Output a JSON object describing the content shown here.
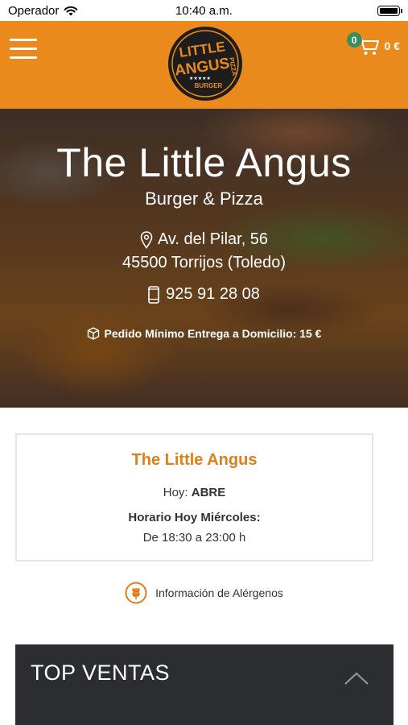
{
  "status_bar": {
    "carrier": "Operador",
    "time": "10:40 a.m."
  },
  "header": {
    "cart_count": "0",
    "cart_total": "0 €",
    "logo_text": [
      "LITTLE",
      "ANGUS",
      "PIZZA",
      "BURGER"
    ],
    "accent_color": "#ea8a1c"
  },
  "hero": {
    "name": "The Little Angus",
    "subtitle": "Burger & Pizza",
    "address_line1": "Av. del Pilar, 56",
    "address_line2": "45500 Torrijos (Toledo)",
    "phone": "925 91 28 08",
    "min_order": "Pedido Mínimo Entrega a Domicilio: 15 €"
  },
  "info_card": {
    "title": "The Little Angus",
    "today_label": "Hoy:",
    "today_value": "ABRE",
    "schedule_heading": "Horario Hoy Miércoles:",
    "schedule_hours": "De 18:30 a 23:00 h"
  },
  "allergens": {
    "label": "Información de Alérgenos"
  },
  "top_ventas": {
    "title": "TOP VENTAS"
  },
  "icons": [
    "wifi-icon",
    "battery-icon",
    "menu-icon",
    "cart-icon",
    "map-pin-icon",
    "phone-icon",
    "box-icon",
    "wheat-icon",
    "chevron-up-icon"
  ]
}
